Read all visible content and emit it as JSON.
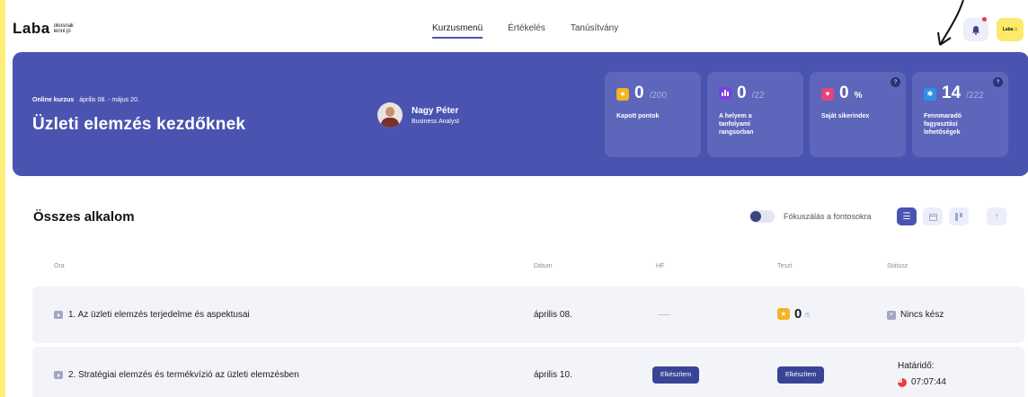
{
  "header": {
    "logo": "Laba",
    "logo_tagline": "okosnak lenni jó",
    "nav": [
      "Kurzusmenü",
      "Értékelés",
      "Tanúsítvány"
    ],
    "active_nav": "Kurzusmenü",
    "avatar_text": "Laba ::"
  },
  "hero": {
    "course_type": "Online kurzus",
    "course_dates": "április 08. - május 20.",
    "course_title": "Üzleti elemzés kezdőknek",
    "teacher_name": "Nagy Péter",
    "teacher_role": "Business Analyst",
    "stats": [
      {
        "icon": "star-icon",
        "value": "0",
        "max": "/200",
        "label": "Kapott pontok",
        "color": "#f5b323",
        "help": false
      },
      {
        "icon": "bar-chart-icon",
        "value": "0",
        "max": "/22",
        "label": "A helyem a tanfolyami rangsorban",
        "color": "#7c3fe0",
        "help": false
      },
      {
        "icon": "heart-icon",
        "value": "0",
        "max": "%",
        "label": "Saját sikerindex",
        "color": "#e2447e",
        "help": true
      },
      {
        "icon": "snowflake-icon",
        "value": "14",
        "max": "/222",
        "label": "Fennmaradó fagyasztási lehetőségek",
        "color": "#2f8fe6",
        "help": true
      }
    ]
  },
  "section": {
    "title": "Összes alkalom",
    "focus_label": "Fókuszálás a fontosokra"
  },
  "table": {
    "headers": {
      "lesson": "Óra",
      "date": "Dátum",
      "hw": "HF",
      "test": "Teszt",
      "status": "Státusz"
    },
    "rows": [
      {
        "title": "1. Az üzleti elemzés terjedelme és aspektusai",
        "date": "április 08.",
        "hw": "—",
        "test_score": "0",
        "test_max": "/5",
        "status": "Nincs kész"
      },
      {
        "title": "2. Stratégiai elemzés és termékvízió az üzleti elemzésben",
        "date": "április 10.",
        "hw_button": "Elkészítem",
        "test_button": "Elkészítem",
        "deadline_label": "Határidő:",
        "deadline_time": "07:07:44"
      }
    ]
  },
  "colors": {
    "brand": "#4a54b0",
    "accent_yellow": "#fde96a",
    "button_dark": "#3a4497"
  }
}
